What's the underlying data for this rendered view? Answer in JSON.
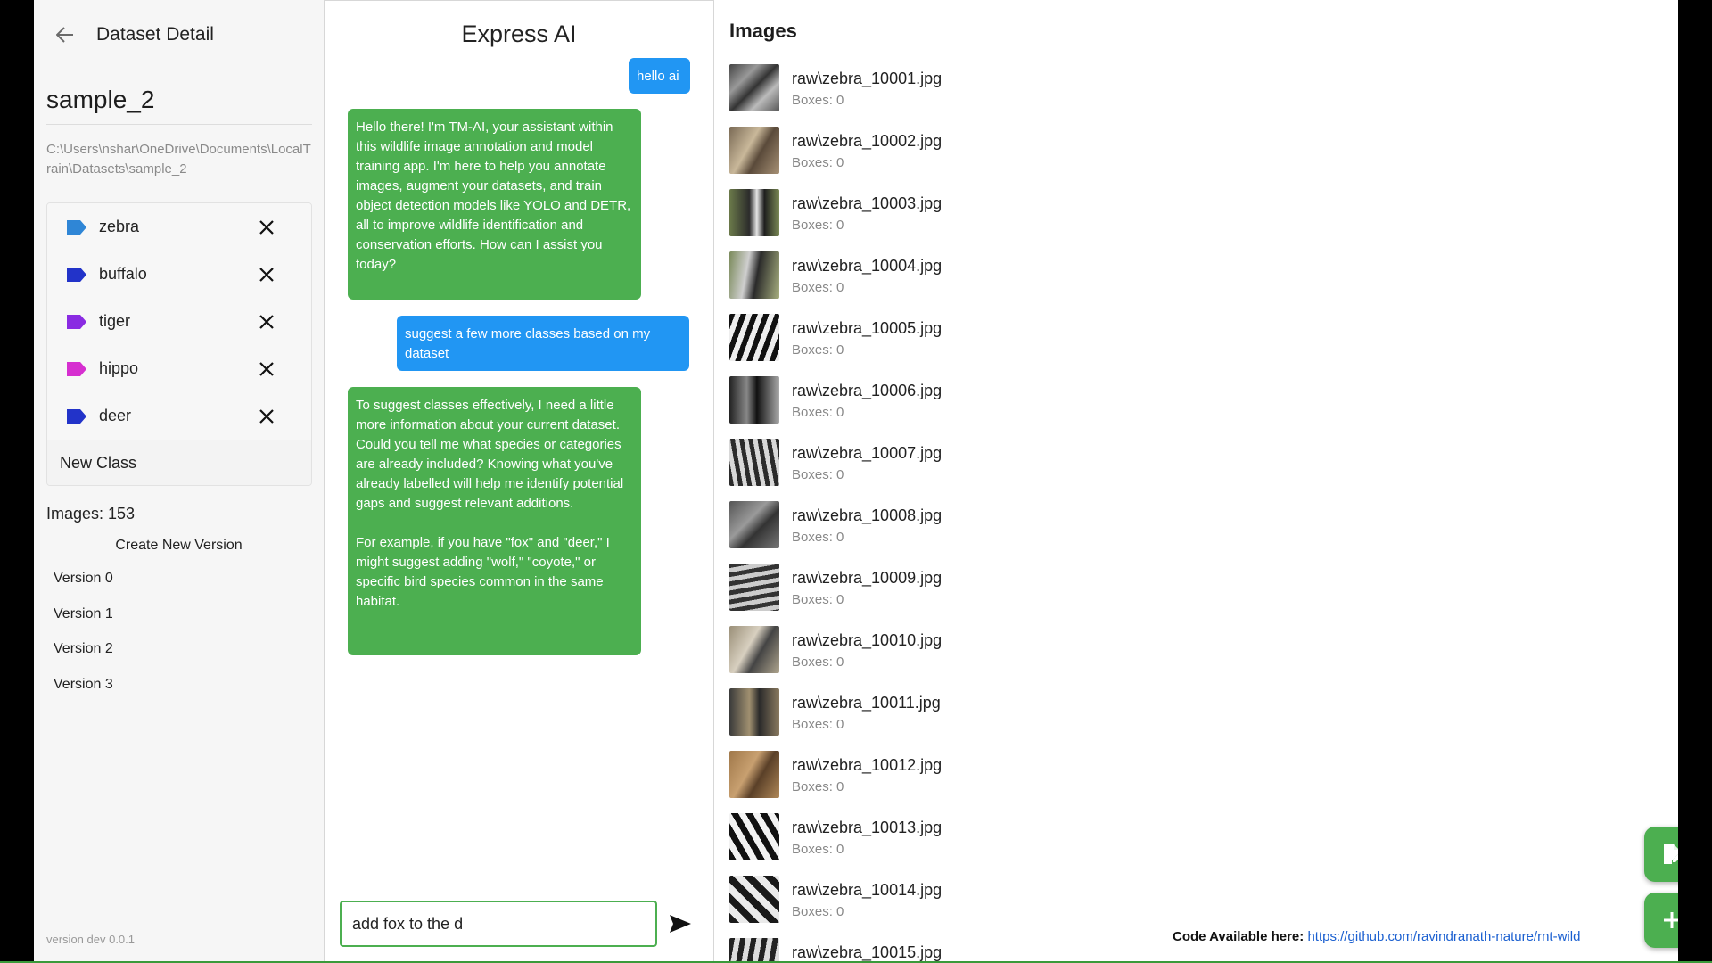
{
  "sidebar": {
    "topbar_title": "Dataset Detail",
    "dataset_name": "sample_2",
    "dataset_path": "C:\\Users\\nshar\\OneDrive\\Documents\\LocalTrain\\Datasets\\sample_2",
    "classes": [
      {
        "label": "zebra",
        "color": "#2f86d6"
      },
      {
        "label": "buffalo",
        "color": "#2233c9"
      },
      {
        "label": "tiger",
        "color": "#8a2be2"
      },
      {
        "label": "hippo",
        "color": "#d62fd0"
      },
      {
        "label": "deer",
        "color": "#2233c9"
      }
    ],
    "new_class_label": "New Class",
    "images_count": "Images: 153",
    "create_version_label": "Create New Version",
    "versions": [
      "Version 0",
      "Version 1",
      "Version 2",
      "Version 3"
    ],
    "version_text": "version dev 0.0.1"
  },
  "chat": {
    "title": "Express AI",
    "messages": [
      {
        "role": "user",
        "text": "hello ai"
      },
      {
        "role": "ai",
        "text": "Hello there! I'm TM-AI, your assistant within this wildlife image annotation and model training app. I'm here to help you annotate images, augment your datasets, and train object detection models like YOLO and DETR, all to improve wildlife identification and conservation efforts. How can I assist you today?"
      },
      {
        "role": "user",
        "text": "suggest a few more classes based on my dataset"
      },
      {
        "role": "ai",
        "text": "To suggest classes effectively, I need a little more information about your current dataset. Could you tell me what species or categories are already included? Knowing what you've already labelled will help me identify potential gaps and suggest relevant additions.\n\nFor example, if you have \"fox\" and \"deer,\" I might suggest adding \"wolf,\" \"coyote,\" or specific bird species common in the same habitat."
      }
    ],
    "input_value": "add fox to the d"
  },
  "images_panel": {
    "heading": "Images",
    "images": [
      {
        "name": "raw\\zebra_10001.jpg",
        "boxes": "Boxes: 0"
      },
      {
        "name": "raw\\zebra_10002.jpg",
        "boxes": "Boxes: 0"
      },
      {
        "name": "raw\\zebra_10003.jpg",
        "boxes": "Boxes: 0"
      },
      {
        "name": "raw\\zebra_10004.jpg",
        "boxes": "Boxes: 0"
      },
      {
        "name": "raw\\zebra_10005.jpg",
        "boxes": "Boxes: 0"
      },
      {
        "name": "raw\\zebra_10006.jpg",
        "boxes": "Boxes: 0"
      },
      {
        "name": "raw\\zebra_10007.jpg",
        "boxes": "Boxes: 0"
      },
      {
        "name": "raw\\zebra_10008.jpg",
        "boxes": "Boxes: 0"
      },
      {
        "name": "raw\\zebra_10009.jpg",
        "boxes": "Boxes: 0"
      },
      {
        "name": "raw\\zebra_10010.jpg",
        "boxes": "Boxes: 0"
      },
      {
        "name": "raw\\zebra_10011.jpg",
        "boxes": "Boxes: 0"
      },
      {
        "name": "raw\\zebra_10012.jpg",
        "boxes": "Boxes: 0"
      },
      {
        "name": "raw\\zebra_10013.jpg",
        "boxes": "Boxes: 0"
      },
      {
        "name": "raw\\zebra_10014.jpg",
        "boxes": "Boxes: 0"
      },
      {
        "name": "raw\\zebra_10015.jpg",
        "boxes": ""
      }
    ],
    "code_label": "Code Available here:",
    "code_link": "https://github.com/ravindranath-nature/rnt-wild"
  },
  "colors": {
    "accent_green": "#4caf50",
    "user_bubble": "#2196f3"
  }
}
